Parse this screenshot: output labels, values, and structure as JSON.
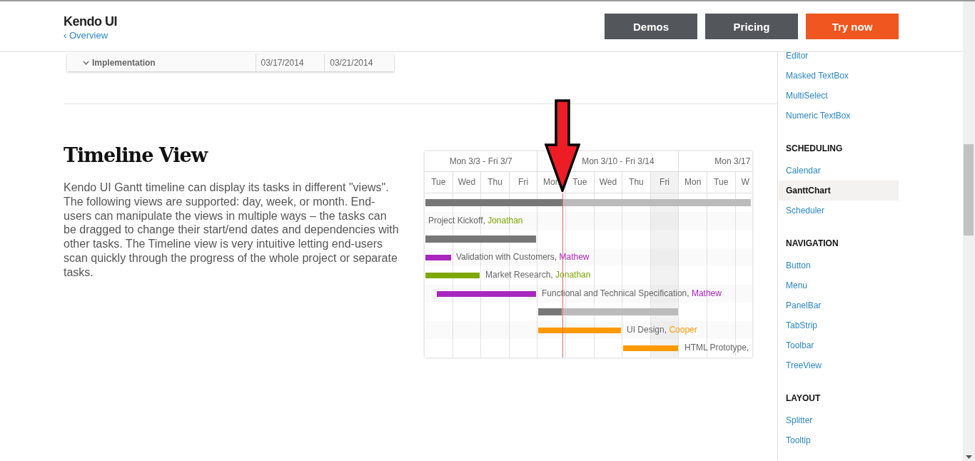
{
  "header": {
    "brand": "Kendo UI",
    "back_link": "‹ Overview",
    "buttons": [
      {
        "label": "Demos",
        "kind": "secondary"
      },
      {
        "label": "Pricing",
        "kind": "secondary"
      },
      {
        "label": "Try now",
        "kind": "primary"
      }
    ]
  },
  "grid_row": {
    "title": "Implementation",
    "expanded": true,
    "start": "03/17/2014",
    "end": "03/21/2014"
  },
  "section": {
    "title": "Timeline View",
    "text": "Kendo UI Gantt timeline can display its tasks in different \"views\". The following views are supported: day, week, or month. End-users can manipulate the views in multiple ways – the tasks can be dragged to change their start/end dates and dependencies with other tasks. The Timeline view is very intuitive letting end-users scan quickly through the progress of the whole project or separate tasks."
  },
  "gantt": {
    "weeks": [
      {
        "label": "Mon 3/3 - Fri 3/7",
        "kind": "full"
      },
      {
        "label": "Mon 3/10 - Fri 3/14",
        "kind": "full"
      },
      {
        "label": "Mon 3/17",
        "kind": "cut"
      }
    ],
    "days": [
      {
        "label": "Tue",
        "highlighted": false
      },
      {
        "label": "Wed",
        "highlighted": false
      },
      {
        "label": "Thu",
        "highlighted": false
      },
      {
        "label": "Fri",
        "highlighted": false
      },
      {
        "label": "Mon",
        "highlighted": false
      },
      {
        "label": "Tue",
        "highlighted": false
      },
      {
        "label": "Wed",
        "highlighted": false
      },
      {
        "label": "Thu",
        "highlighted": false
      },
      {
        "label": "Fri",
        "highlighted": true
      },
      {
        "label": "Mon",
        "highlighted": false
      },
      {
        "label": "Tue",
        "highlighted": false
      },
      {
        "label": "W",
        "highlighted": false
      }
    ],
    "tasks": [
      {
        "kind": "summary",
        "level": 0.42
      },
      {
        "kind": "label",
        "title": "Project Kickoff,",
        "resource": "Jonathan",
        "color": "#7ea700"
      },
      {
        "kind": "summary",
        "level": 1
      },
      {
        "kind": "task",
        "title": "Validation with Customers,",
        "resource": "Mathew",
        "color": "#a926bf"
      },
      {
        "kind": "task",
        "title": "Market Research,",
        "resource": "Jonathan",
        "color": "#7ea700"
      },
      {
        "kind": "task",
        "title": "Functional and Technical Specification,",
        "resource": "Mathew",
        "color": "#a926bf"
      },
      {
        "kind": "summary",
        "level": 0.17
      },
      {
        "kind": "task",
        "title": "UI Design,",
        "resource": "Cooper",
        "color": "#ff9900"
      },
      {
        "kind": "task",
        "title": "HTML Prototype,",
        "color": "#ff9900"
      }
    ]
  },
  "sidebar": {
    "sections": [
      {
        "items": [
          {
            "label": "Editor",
            "selected": false
          },
          {
            "label": "Masked TextBox",
            "selected": false
          },
          {
            "label": "MultiSelect",
            "selected": false
          },
          {
            "label": "Numeric TextBox",
            "selected": false
          }
        ]
      },
      {
        "heading": "SCHEDULING",
        "items": [
          {
            "label": "Calendar",
            "selected": false
          },
          {
            "label": "GanttChart",
            "selected": true
          },
          {
            "label": "Scheduler",
            "selected": false
          }
        ]
      },
      {
        "heading": "NAVIGATION",
        "items": [
          {
            "label": "Button",
            "selected": false
          },
          {
            "label": "Menu",
            "selected": false
          },
          {
            "label": "PanelBar",
            "selected": false
          },
          {
            "label": "TabStrip",
            "selected": false
          },
          {
            "label": "Toolbar",
            "selected": false
          },
          {
            "label": "TreeView",
            "selected": false
          }
        ]
      },
      {
        "heading": "LAYOUT",
        "items": [
          {
            "label": "Splitter",
            "selected": false
          },
          {
            "label": "Tooltip",
            "selected": false
          }
        ]
      }
    ]
  }
}
